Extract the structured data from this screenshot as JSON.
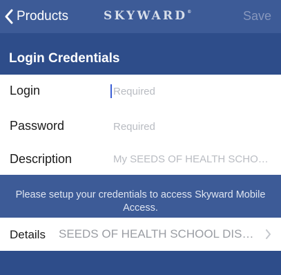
{
  "colors": {
    "background": "#2e4d8a",
    "bar": "#3d5b97",
    "accent_caret": "#3a5dd6"
  },
  "navbar": {
    "back_label": "Products",
    "back_icon": "chevron-left-icon",
    "brand_text": "SKYWARD",
    "brand_mark": "®",
    "save_label": "Save"
  },
  "section": {
    "title": "Login Credentials"
  },
  "form": {
    "login": {
      "label": "Login",
      "placeholder": "Required",
      "value": ""
    },
    "password": {
      "label": "Password",
      "placeholder": "Required",
      "value": ""
    },
    "description": {
      "label": "Description",
      "placeholder": "My SEEDS OF HEALTH SCHOOL DISTRICT"
    }
  },
  "info": {
    "text": "Please setup your credentials to access Skyward Mobile Access."
  },
  "details": {
    "label": "Details",
    "value": "SEEDS OF HEALTH SCHOOL DISTRICT",
    "icon": "chevron-right-icon"
  }
}
